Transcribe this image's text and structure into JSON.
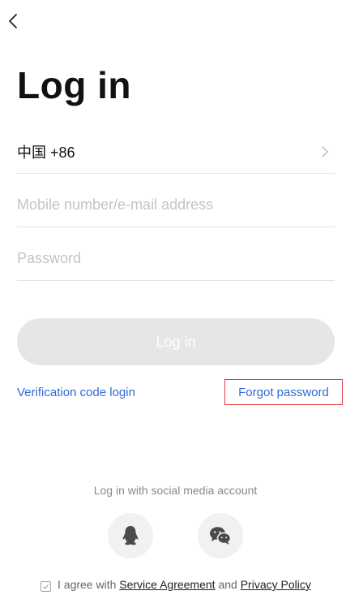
{
  "header": {
    "back_icon": "chevron-left-icon"
  },
  "title": "Log in",
  "country": {
    "label": "中国 +86",
    "chevron_icon": "chevron-right-icon"
  },
  "fields": {
    "account_placeholder": "Mobile number/e-mail address",
    "password_placeholder": "Password"
  },
  "login_button": "Log in",
  "links": {
    "verification": "Verification code login",
    "forgot": "Forgot password"
  },
  "social": {
    "caption": "Log in with social media account",
    "qq_icon": "qq-penguin-icon",
    "wechat_icon": "wechat-icon"
  },
  "agreement": {
    "prefix": "I agree with",
    "service": "Service Agreement",
    "and": "and",
    "privacy": "Privacy Policy"
  },
  "colors": {
    "link": "#2f6ad8",
    "button_disabled": "#e6e6e6",
    "highlight_box": "#e23c3c"
  }
}
